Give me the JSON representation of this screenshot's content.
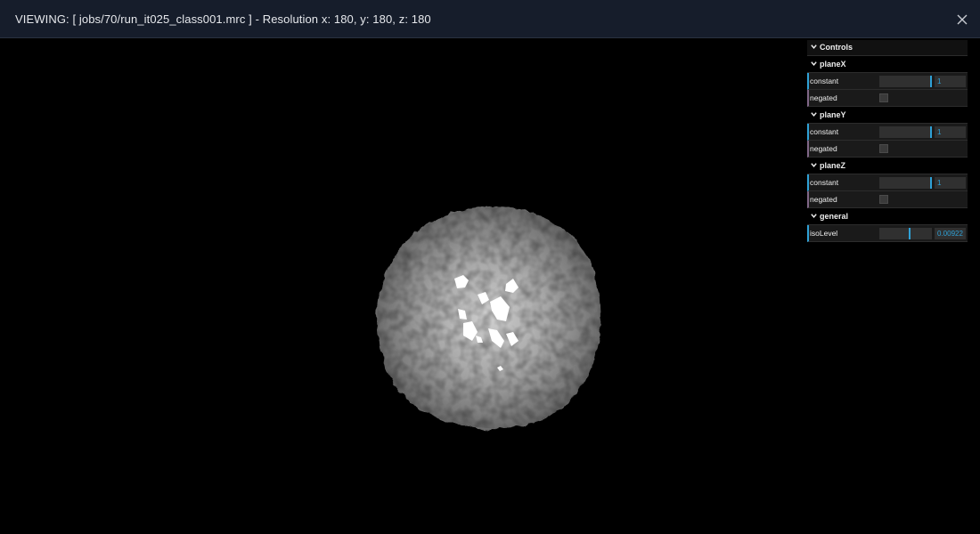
{
  "header": {
    "title": "VIEWING: [ jobs/70/run_it025_class001.mrc ] - Resolution x: 180, y: 180, z: 180",
    "close_icon": "close-icon"
  },
  "controls": {
    "title": "Controls",
    "planeX": {
      "title": "planeX",
      "constant_label": "constant",
      "constant_value": "1",
      "constant_fraction": 1,
      "negated_label": "negated",
      "negated": false
    },
    "planeY": {
      "title": "planeY",
      "constant_label": "constant",
      "constant_value": "1",
      "constant_fraction": 1,
      "negated_label": "negated",
      "negated": false
    },
    "planeZ": {
      "title": "planeZ",
      "constant_label": "constant",
      "constant_value": "1",
      "constant_fraction": 1,
      "negated_label": "negated",
      "negated": false
    },
    "general": {
      "title": "general",
      "isolevel_label": "isoLevel",
      "isolevel_value": "0.00922",
      "isolevel_fraction": 0.6
    }
  },
  "colors": {
    "header_bg": "#161d2b",
    "viewport_bg": "#000000",
    "slider_accent": "#2fa1d6",
    "panel_bg": "#1a1a1a"
  }
}
